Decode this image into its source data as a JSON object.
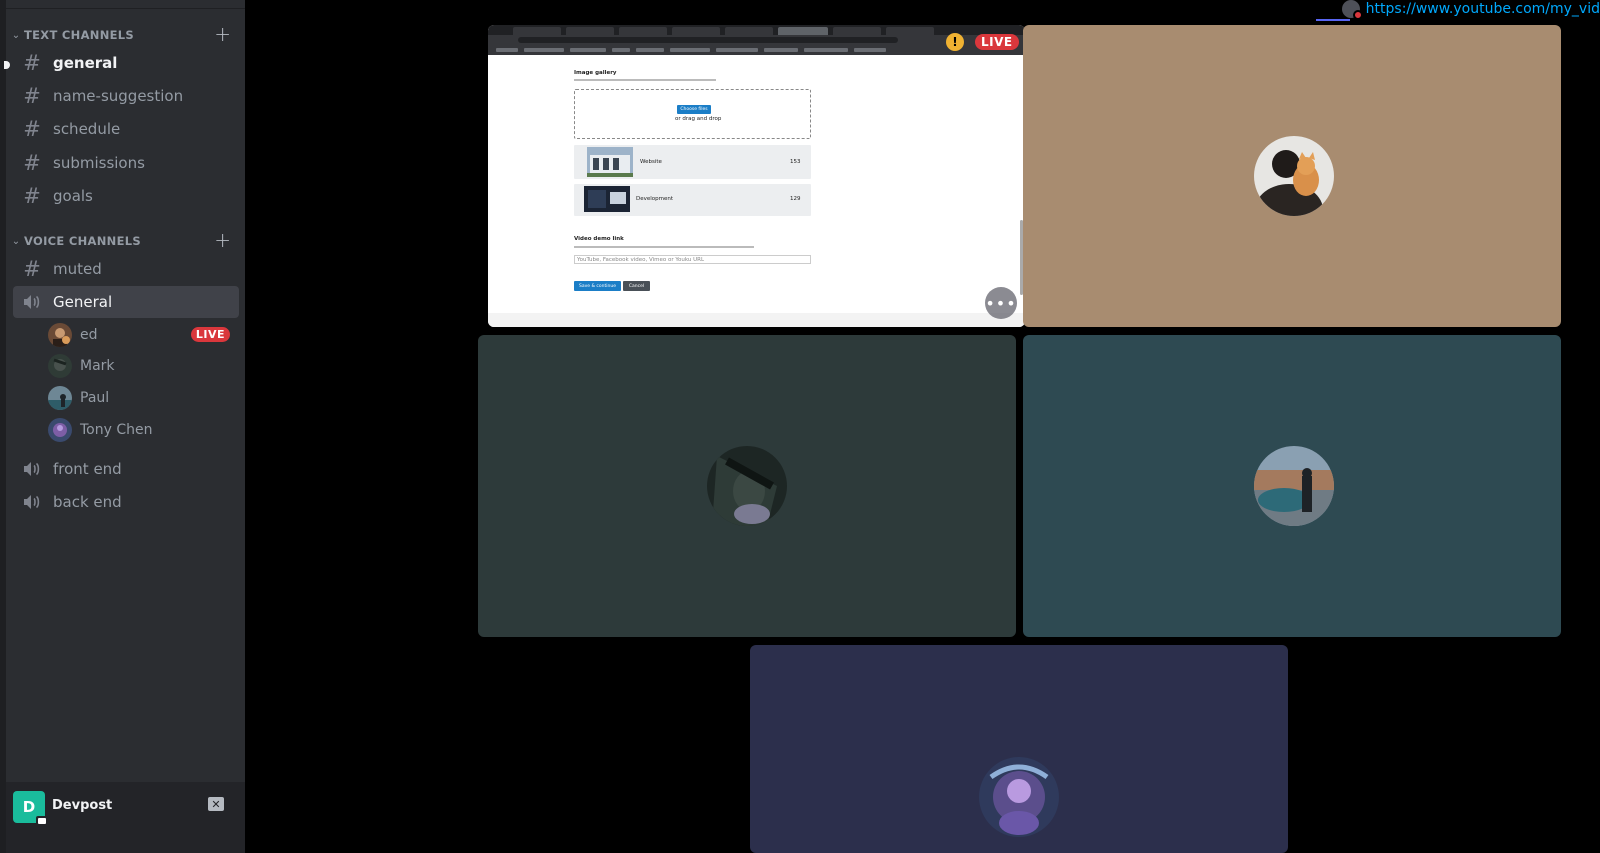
{
  "sidebar": {
    "text_channels_label": "TEXT CHANNELS",
    "voice_channels_label": "VOICE CHANNELS",
    "text_channels": [
      {
        "name": "general",
        "selected": true
      },
      {
        "name": "name-suggestion"
      },
      {
        "name": "schedule"
      },
      {
        "name": "submissions"
      },
      {
        "name": "goals"
      }
    ],
    "voice_channels": [
      {
        "name": "muted",
        "icon": "hash-icon"
      },
      {
        "name": "General",
        "icon": "speaker-icon",
        "active": true
      },
      {
        "name": "front end",
        "icon": "speaker-icon"
      },
      {
        "name": "back end",
        "icon": "speaker-icon"
      }
    ],
    "voice_users": [
      {
        "name": "ed",
        "live": true,
        "live_label": "LIVE"
      },
      {
        "name": "Mark"
      },
      {
        "name": "Paul"
      },
      {
        "name": "Tony Chen"
      }
    ]
  },
  "bottom_panel": {
    "server_initial": "D",
    "server_name": "Devpost",
    "disconnect_icon": "screen-disconnect-icon"
  },
  "stage": {
    "corner_url": "https://www.youtube.com/my_vid",
    "stream_live_label": "LIVE",
    "warning_glyph": "!",
    "more_glyph": "•••",
    "screen_share": {
      "section_title": "Image gallery",
      "choose_files": "Choose files",
      "drag_drop": "or drag and drop",
      "rows": [
        {
          "name": "Website",
          "count": "153"
        },
        {
          "name": "Development",
          "count": "129"
        }
      ],
      "video_demo_label": "Video demo link",
      "input_placeholder": "YouTube, Facebook video, Vimeo or Youku URL",
      "save_label": "Save & continue",
      "cancel_label": "Cancel"
    },
    "tile_colors": {
      "tile2": "#a88c70",
      "tile3": "#2d3a3a",
      "tile4": "#2e4a52",
      "tile5": "#2c2f4c"
    }
  }
}
